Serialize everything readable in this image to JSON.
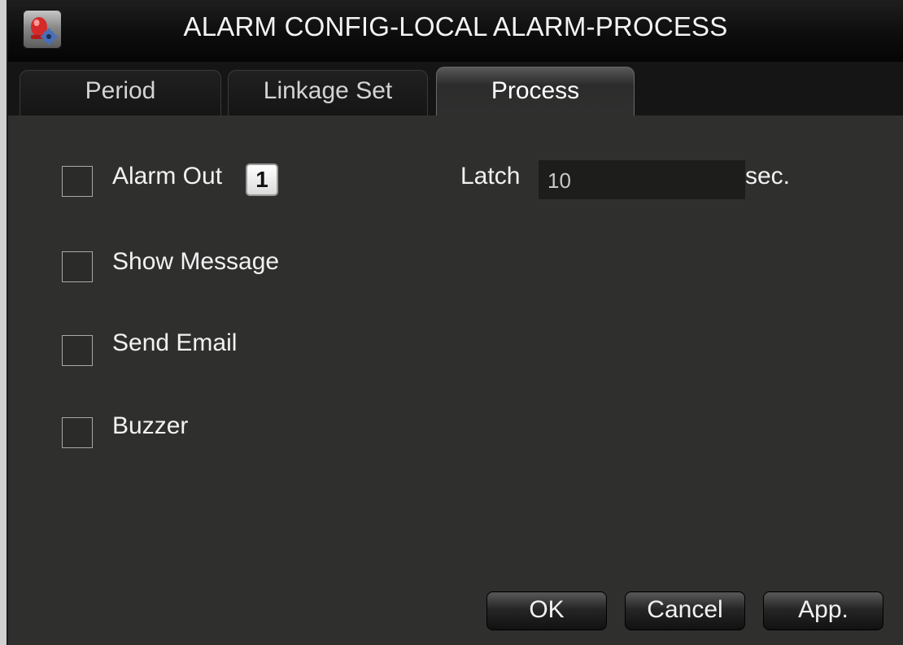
{
  "window": {
    "title": "ALARM CONFIG-LOCAL ALARM-PROCESS",
    "icon": "settings-alarm-icon"
  },
  "tabs": [
    {
      "label": "Period",
      "active": false
    },
    {
      "label": "Linkage Set",
      "active": false
    },
    {
      "label": "Process",
      "active": true
    }
  ],
  "options": {
    "alarm_out": {
      "label": "Alarm Out",
      "checked": false,
      "channel": "1"
    },
    "show_message": {
      "label": "Show Message",
      "checked": false
    },
    "send_email": {
      "label": "Send Email",
      "checked": false
    },
    "buzzer": {
      "label": "Buzzer",
      "checked": false
    }
  },
  "latch": {
    "label": "Latch",
    "value": "10",
    "unit": "sec."
  },
  "buttons": {
    "ok": "OK",
    "cancel": "Cancel",
    "apply": "App."
  },
  "colors": {
    "background": "#2f302e",
    "titlebar": "#0c0c0c",
    "text": "#f2f2f2"
  }
}
